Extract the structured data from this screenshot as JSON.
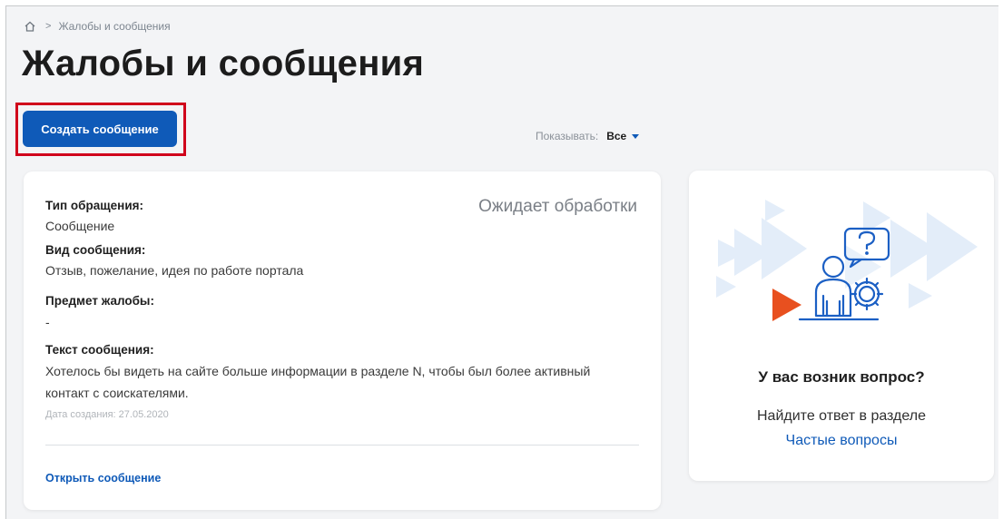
{
  "breadcrumb": {
    "home_icon": "home-icon",
    "separator": ">",
    "current": "Жалобы и сообщения"
  },
  "page": {
    "title": "Жалобы и сообщения"
  },
  "toolbar": {
    "create_label": "Создать сообщение",
    "filter_label": "Показывать:",
    "filter_value": "Все",
    "filter_icon": "caret-down-icon",
    "highlight_color": "#d0021b"
  },
  "card": {
    "status": "Ожидает обработки",
    "fields": [
      {
        "label": "Тип обращения:",
        "value": "Сообщение"
      },
      {
        "label": "Вид сообщения:",
        "value": "Отзыв, пожелание, идея по работе портала"
      },
      {
        "label": "Предмет жалобы:",
        "value": "-"
      },
      {
        "label": "Текст сообщения:",
        "value": "Хотелось бы видеть на сайте больше информации в разделе N, чтобы был более активный контакт с соискателями."
      }
    ],
    "date": "Дата создания: 27.05.2020",
    "open_link": "Открыть сообщение"
  },
  "help": {
    "illustration_icon": "support-person-illustration",
    "question": "У вас возник вопрос?",
    "text": "Найдите ответ в разделе",
    "link": "Частые вопросы"
  },
  "colors": {
    "accent": "#0f5ab8",
    "play_orange": "#e8501f",
    "illustration_blue": "#1b5fc4",
    "light_blue": "#dfeaf8"
  }
}
